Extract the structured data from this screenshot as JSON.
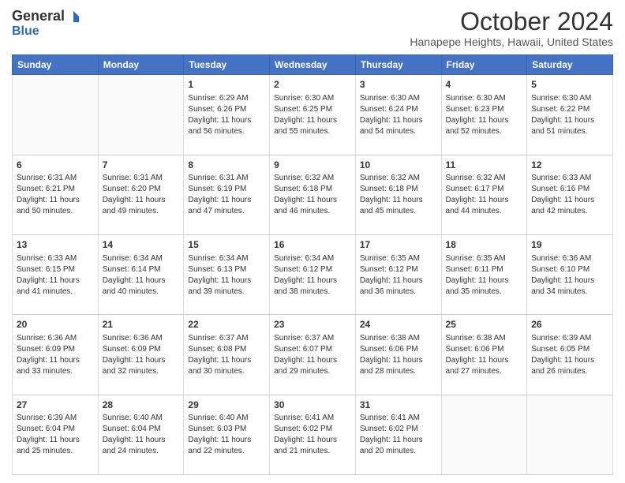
{
  "logo": {
    "general": "General",
    "blue": "Blue"
  },
  "header": {
    "month": "October 2024",
    "location": "Hanapepe Heights, Hawaii, United States"
  },
  "days_of_week": [
    "Sunday",
    "Monday",
    "Tuesday",
    "Wednesday",
    "Thursday",
    "Friday",
    "Saturday"
  ],
  "weeks": [
    [
      {
        "day": "",
        "info": ""
      },
      {
        "day": "",
        "info": ""
      },
      {
        "day": "1",
        "info": "Sunrise: 6:29 AM\nSunset: 6:26 PM\nDaylight: 11 hours and 56 minutes."
      },
      {
        "day": "2",
        "info": "Sunrise: 6:30 AM\nSunset: 6:25 PM\nDaylight: 11 hours and 55 minutes."
      },
      {
        "day": "3",
        "info": "Sunrise: 6:30 AM\nSunset: 6:24 PM\nDaylight: 11 hours and 54 minutes."
      },
      {
        "day": "4",
        "info": "Sunrise: 6:30 AM\nSunset: 6:23 PM\nDaylight: 11 hours and 52 minutes."
      },
      {
        "day": "5",
        "info": "Sunrise: 6:30 AM\nSunset: 6:22 PM\nDaylight: 11 hours and 51 minutes."
      }
    ],
    [
      {
        "day": "6",
        "info": "Sunrise: 6:31 AM\nSunset: 6:21 PM\nDaylight: 11 hours and 50 minutes."
      },
      {
        "day": "7",
        "info": "Sunrise: 6:31 AM\nSunset: 6:20 PM\nDaylight: 11 hours and 49 minutes."
      },
      {
        "day": "8",
        "info": "Sunrise: 6:31 AM\nSunset: 6:19 PM\nDaylight: 11 hours and 47 minutes."
      },
      {
        "day": "9",
        "info": "Sunrise: 6:32 AM\nSunset: 6:18 PM\nDaylight: 11 hours and 46 minutes."
      },
      {
        "day": "10",
        "info": "Sunrise: 6:32 AM\nSunset: 6:18 PM\nDaylight: 11 hours and 45 minutes."
      },
      {
        "day": "11",
        "info": "Sunrise: 6:32 AM\nSunset: 6:17 PM\nDaylight: 11 hours and 44 minutes."
      },
      {
        "day": "12",
        "info": "Sunrise: 6:33 AM\nSunset: 6:16 PM\nDaylight: 11 hours and 42 minutes."
      }
    ],
    [
      {
        "day": "13",
        "info": "Sunrise: 6:33 AM\nSunset: 6:15 PM\nDaylight: 11 hours and 41 minutes."
      },
      {
        "day": "14",
        "info": "Sunrise: 6:34 AM\nSunset: 6:14 PM\nDaylight: 11 hours and 40 minutes."
      },
      {
        "day": "15",
        "info": "Sunrise: 6:34 AM\nSunset: 6:13 PM\nDaylight: 11 hours and 39 minutes."
      },
      {
        "day": "16",
        "info": "Sunrise: 6:34 AM\nSunset: 6:12 PM\nDaylight: 11 hours and 38 minutes."
      },
      {
        "day": "17",
        "info": "Sunrise: 6:35 AM\nSunset: 6:12 PM\nDaylight: 11 hours and 36 minutes."
      },
      {
        "day": "18",
        "info": "Sunrise: 6:35 AM\nSunset: 6:11 PM\nDaylight: 11 hours and 35 minutes."
      },
      {
        "day": "19",
        "info": "Sunrise: 6:36 AM\nSunset: 6:10 PM\nDaylight: 11 hours and 34 minutes."
      }
    ],
    [
      {
        "day": "20",
        "info": "Sunrise: 6:36 AM\nSunset: 6:09 PM\nDaylight: 11 hours and 33 minutes."
      },
      {
        "day": "21",
        "info": "Sunrise: 6:36 AM\nSunset: 6:09 PM\nDaylight: 11 hours and 32 minutes."
      },
      {
        "day": "22",
        "info": "Sunrise: 6:37 AM\nSunset: 6:08 PM\nDaylight: 11 hours and 30 minutes."
      },
      {
        "day": "23",
        "info": "Sunrise: 6:37 AM\nSunset: 6:07 PM\nDaylight: 11 hours and 29 minutes."
      },
      {
        "day": "24",
        "info": "Sunrise: 6:38 AM\nSunset: 6:06 PM\nDaylight: 11 hours and 28 minutes."
      },
      {
        "day": "25",
        "info": "Sunrise: 6:38 AM\nSunset: 6:06 PM\nDaylight: 11 hours and 27 minutes."
      },
      {
        "day": "26",
        "info": "Sunrise: 6:39 AM\nSunset: 6:05 PM\nDaylight: 11 hours and 26 minutes."
      }
    ],
    [
      {
        "day": "27",
        "info": "Sunrise: 6:39 AM\nSunset: 6:04 PM\nDaylight: 11 hours and 25 minutes."
      },
      {
        "day": "28",
        "info": "Sunrise: 6:40 AM\nSunset: 6:04 PM\nDaylight: 11 hours and 24 minutes."
      },
      {
        "day": "29",
        "info": "Sunrise: 6:40 AM\nSunset: 6:03 PM\nDaylight: 11 hours and 22 minutes."
      },
      {
        "day": "30",
        "info": "Sunrise: 6:41 AM\nSunset: 6:02 PM\nDaylight: 11 hours and 21 minutes."
      },
      {
        "day": "31",
        "info": "Sunrise: 6:41 AM\nSunset: 6:02 PM\nDaylight: 11 hours and 20 minutes."
      },
      {
        "day": "",
        "info": ""
      },
      {
        "day": "",
        "info": ""
      }
    ]
  ]
}
